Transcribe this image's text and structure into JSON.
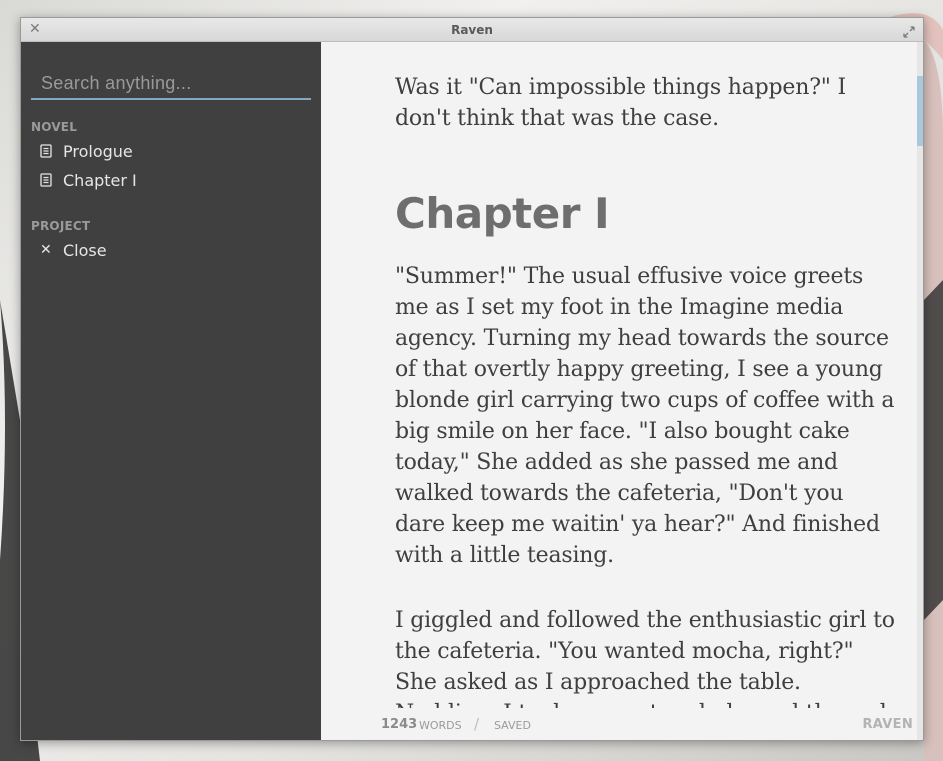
{
  "window": {
    "title": "Raven"
  },
  "sidebar": {
    "search_placeholder": "Search anything...",
    "sections": [
      {
        "label": "NOVEL",
        "items": [
          {
            "label": "Prologue",
            "icon": "document-icon"
          },
          {
            "label": "Chapter I",
            "icon": "document-icon"
          }
        ]
      },
      {
        "label": "PROJECT",
        "items": [
          {
            "label": "Close",
            "icon": "close-icon"
          }
        ]
      }
    ]
  },
  "editor": {
    "paragraphs_before": [
      "Was it \"Can impossible things happen?\" I don't think that was the case."
    ],
    "heading": "Chapter I",
    "paragraphs_after": [
      "\"Summer!\" The usual effusive voice greets me as I set my foot in the Imagine media agency. Turning my head towards the source of that overtly happy greeting, I see a young blonde girl carrying two cups of coffee with a big smile on her face. \"I also bought cake today,\" She added as she passed me and walked towards the cafeteria, \"Don't you dare keep me waitin' ya hear?\" And finished with a little teasing.",
      "I giggled and followed the enthusiastic girl to the cafeteria. \"You wanted mocha, right?\" She asked as I approached the table. Nodding, I took my seat and glanced through the things"
    ]
  },
  "status": {
    "word_count": "1243",
    "words_label": "WORDS",
    "separator": "/",
    "saved_label": "SAVED",
    "brand": "RAVEN"
  },
  "colors": {
    "sidebar_bg": "#404040",
    "accent": "#7fa9c4",
    "editor_bg": "#f3f3f3",
    "text": "#3f3f3f"
  }
}
